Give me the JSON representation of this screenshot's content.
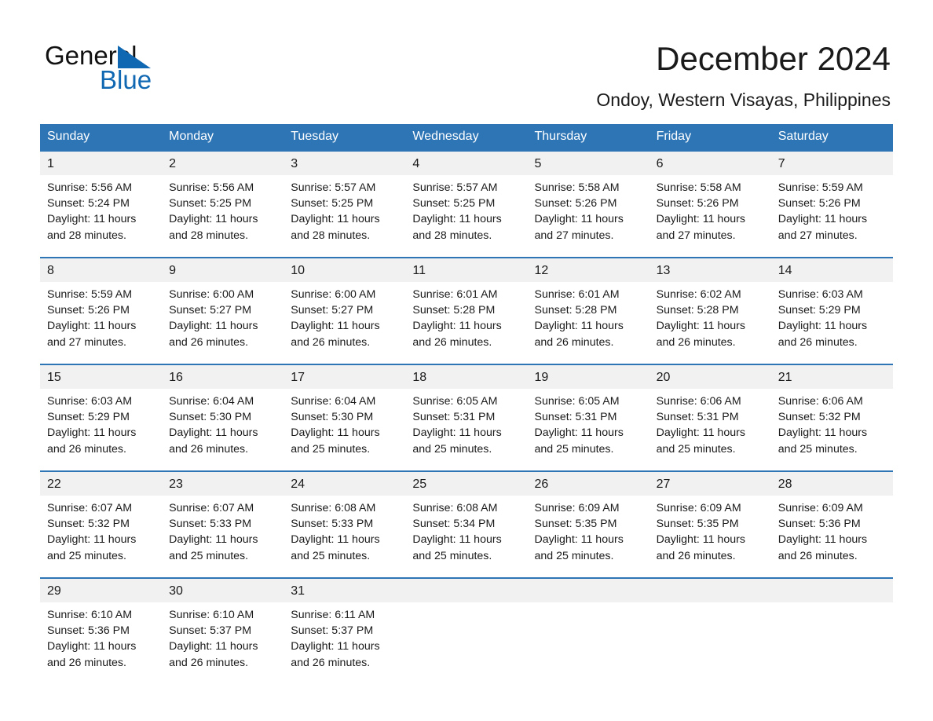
{
  "brand": {
    "name_part1": "General",
    "name_part2": "Blue",
    "flag_icon": "triangle-flag-icon",
    "accent_color": "#1068b3"
  },
  "header": {
    "title": "December 2024",
    "location": "Ondoy, Western Visayas, Philippines"
  },
  "theme": {
    "header_bg": "#2e75b6",
    "date_band_bg": "#f1f1f1",
    "cell_bg": "#ffffff",
    "text": "#1a1a1a"
  },
  "weekday_headers": [
    "Sunday",
    "Monday",
    "Tuesday",
    "Wednesday",
    "Thursday",
    "Friday",
    "Saturday"
  ],
  "weeks": [
    {
      "dates": [
        "1",
        "2",
        "3",
        "4",
        "5",
        "6",
        "7"
      ],
      "cells": [
        {
          "sunrise": "Sunrise: 5:56 AM",
          "sunset": "Sunset: 5:24 PM",
          "daylight": "Daylight: 11 hours and 28 minutes."
        },
        {
          "sunrise": "Sunrise: 5:56 AM",
          "sunset": "Sunset: 5:25 PM",
          "daylight": "Daylight: 11 hours and 28 minutes."
        },
        {
          "sunrise": "Sunrise: 5:57 AM",
          "sunset": "Sunset: 5:25 PM",
          "daylight": "Daylight: 11 hours and 28 minutes."
        },
        {
          "sunrise": "Sunrise: 5:57 AM",
          "sunset": "Sunset: 5:25 PM",
          "daylight": "Daylight: 11 hours and 28 minutes."
        },
        {
          "sunrise": "Sunrise: 5:58 AM",
          "sunset": "Sunset: 5:26 PM",
          "daylight": "Daylight: 11 hours and 27 minutes."
        },
        {
          "sunrise": "Sunrise: 5:58 AM",
          "sunset": "Sunset: 5:26 PM",
          "daylight": "Daylight: 11 hours and 27 minutes."
        },
        {
          "sunrise": "Sunrise: 5:59 AM",
          "sunset": "Sunset: 5:26 PM",
          "daylight": "Daylight: 11 hours and 27 minutes."
        }
      ]
    },
    {
      "dates": [
        "8",
        "9",
        "10",
        "11",
        "12",
        "13",
        "14"
      ],
      "cells": [
        {
          "sunrise": "Sunrise: 5:59 AM",
          "sunset": "Sunset: 5:26 PM",
          "daylight": "Daylight: 11 hours and 27 minutes."
        },
        {
          "sunrise": "Sunrise: 6:00 AM",
          "sunset": "Sunset: 5:27 PM",
          "daylight": "Daylight: 11 hours and 26 minutes."
        },
        {
          "sunrise": "Sunrise: 6:00 AM",
          "sunset": "Sunset: 5:27 PM",
          "daylight": "Daylight: 11 hours and 26 minutes."
        },
        {
          "sunrise": "Sunrise: 6:01 AM",
          "sunset": "Sunset: 5:28 PM",
          "daylight": "Daylight: 11 hours and 26 minutes."
        },
        {
          "sunrise": "Sunrise: 6:01 AM",
          "sunset": "Sunset: 5:28 PM",
          "daylight": "Daylight: 11 hours and 26 minutes."
        },
        {
          "sunrise": "Sunrise: 6:02 AM",
          "sunset": "Sunset: 5:28 PM",
          "daylight": "Daylight: 11 hours and 26 minutes."
        },
        {
          "sunrise": "Sunrise: 6:03 AM",
          "sunset": "Sunset: 5:29 PM",
          "daylight": "Daylight: 11 hours and 26 minutes."
        }
      ]
    },
    {
      "dates": [
        "15",
        "16",
        "17",
        "18",
        "19",
        "20",
        "21"
      ],
      "cells": [
        {
          "sunrise": "Sunrise: 6:03 AM",
          "sunset": "Sunset: 5:29 PM",
          "daylight": "Daylight: 11 hours and 26 minutes."
        },
        {
          "sunrise": "Sunrise: 6:04 AM",
          "sunset": "Sunset: 5:30 PM",
          "daylight": "Daylight: 11 hours and 26 minutes."
        },
        {
          "sunrise": "Sunrise: 6:04 AM",
          "sunset": "Sunset: 5:30 PM",
          "daylight": "Daylight: 11 hours and 25 minutes."
        },
        {
          "sunrise": "Sunrise: 6:05 AM",
          "sunset": "Sunset: 5:31 PM",
          "daylight": "Daylight: 11 hours and 25 minutes."
        },
        {
          "sunrise": "Sunrise: 6:05 AM",
          "sunset": "Sunset: 5:31 PM",
          "daylight": "Daylight: 11 hours and 25 minutes."
        },
        {
          "sunrise": "Sunrise: 6:06 AM",
          "sunset": "Sunset: 5:31 PM",
          "daylight": "Daylight: 11 hours and 25 minutes."
        },
        {
          "sunrise": "Sunrise: 6:06 AM",
          "sunset": "Sunset: 5:32 PM",
          "daylight": "Daylight: 11 hours and 25 minutes."
        }
      ]
    },
    {
      "dates": [
        "22",
        "23",
        "24",
        "25",
        "26",
        "27",
        "28"
      ],
      "cells": [
        {
          "sunrise": "Sunrise: 6:07 AM",
          "sunset": "Sunset: 5:32 PM",
          "daylight": "Daylight: 11 hours and 25 minutes."
        },
        {
          "sunrise": "Sunrise: 6:07 AM",
          "sunset": "Sunset: 5:33 PM",
          "daylight": "Daylight: 11 hours and 25 minutes."
        },
        {
          "sunrise": "Sunrise: 6:08 AM",
          "sunset": "Sunset: 5:33 PM",
          "daylight": "Daylight: 11 hours and 25 minutes."
        },
        {
          "sunrise": "Sunrise: 6:08 AM",
          "sunset": "Sunset: 5:34 PM",
          "daylight": "Daylight: 11 hours and 25 minutes."
        },
        {
          "sunrise": "Sunrise: 6:09 AM",
          "sunset": "Sunset: 5:35 PM",
          "daylight": "Daylight: 11 hours and 25 minutes."
        },
        {
          "sunrise": "Sunrise: 6:09 AM",
          "sunset": "Sunset: 5:35 PM",
          "daylight": "Daylight: 11 hours and 26 minutes."
        },
        {
          "sunrise": "Sunrise: 6:09 AM",
          "sunset": "Sunset: 5:36 PM",
          "daylight": "Daylight: 11 hours and 26 minutes."
        }
      ]
    },
    {
      "dates": [
        "29",
        "30",
        "31",
        "",
        "",
        "",
        ""
      ],
      "cells": [
        {
          "sunrise": "Sunrise: 6:10 AM",
          "sunset": "Sunset: 5:36 PM",
          "daylight": "Daylight: 11 hours and 26 minutes."
        },
        {
          "sunrise": "Sunrise: 6:10 AM",
          "sunset": "Sunset: 5:37 PM",
          "daylight": "Daylight: 11 hours and 26 minutes."
        },
        {
          "sunrise": "Sunrise: 6:11 AM",
          "sunset": "Sunset: 5:37 PM",
          "daylight": "Daylight: 11 hours and 26 minutes."
        },
        {
          "sunrise": "",
          "sunset": "",
          "daylight": ""
        },
        {
          "sunrise": "",
          "sunset": "",
          "daylight": ""
        },
        {
          "sunrise": "",
          "sunset": "",
          "daylight": ""
        },
        {
          "sunrise": "",
          "sunset": "",
          "daylight": ""
        }
      ]
    }
  ]
}
